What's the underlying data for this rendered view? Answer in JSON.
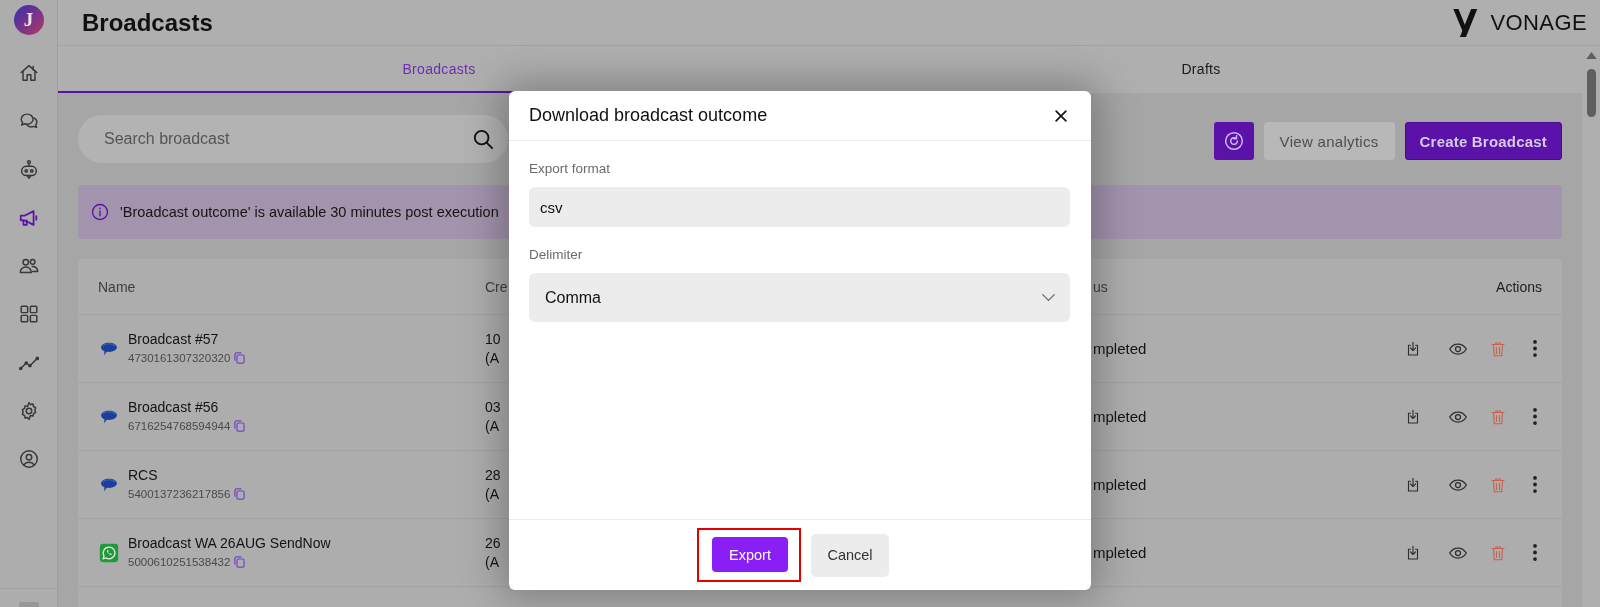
{
  "sidebar": {
    "logo": "J",
    "items": [
      {
        "selected": false
      },
      {
        "selected": false
      },
      {
        "selected": false
      },
      {
        "selected": true
      },
      {
        "selected": false
      },
      {
        "selected": false
      },
      {
        "selected": false
      },
      {
        "selected": false
      },
      {
        "selected": false
      }
    ]
  },
  "header": {
    "title": "Broadcasts",
    "brand": "VONAGE"
  },
  "tabs": [
    {
      "label": "Broadcasts",
      "selected": true
    },
    {
      "label": "Drafts",
      "selected": false
    }
  ],
  "toolbar": {
    "search": {
      "placeholder": "Search broadcast"
    },
    "buttons": [
      {
        "kind": "refresh"
      },
      {
        "kind": "secondary",
        "label": "View analytics"
      },
      {
        "kind": "primary",
        "label": "Create Broadcast"
      }
    ]
  },
  "notice": {
    "text": "'Broadcast outcome' is available 30 minutes post execution"
  },
  "table": {
    "columns": [
      "Name",
      "Cre",
      "us",
      "Actions"
    ],
    "rows": [
      {
        "kind": "bubble",
        "name": "Broadcast #57",
        "id": "4730161307320320",
        "column_2": [
          "10",
          "(A"
        ],
        "column_3": "mpleted"
      },
      {
        "kind": "bubble",
        "name": "Broadcast #56",
        "id": "6716254768594944",
        "column_2": [
          "03",
          "(A"
        ],
        "column_3": "mpleted"
      },
      {
        "kind": "bubble",
        "name": "RCS",
        "id": "5400137236217856",
        "column_2": [
          "28",
          "(A"
        ],
        "column_3": "mpleted"
      },
      {
        "kind": "tile",
        "name": "Broadcast WA 26AUG SendNow",
        "id": "5000610251538432",
        "column_2": [
          "26",
          "(A"
        ],
        "column_3": "mpleted"
      }
    ]
  },
  "dialog": {
    "title": "Download broadcast outcome",
    "fields": [
      {
        "kind": "text",
        "label": "Export format",
        "value": "csv"
      },
      {
        "kind": "select",
        "label": "Delimiter",
        "value": "Comma"
      }
    ],
    "buttons": [
      {
        "kind": "primary",
        "label": "Export",
        "highlighted": true
      },
      {
        "kind": "secondary",
        "label": "Cancel",
        "highlighted": false
      }
    ]
  }
}
